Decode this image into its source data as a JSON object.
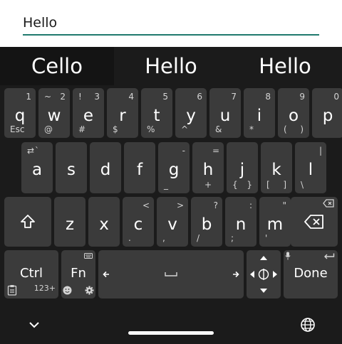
{
  "input": {
    "value": "Hello"
  },
  "suggestions": [
    "Cello",
    "Hello",
    "Hello"
  ],
  "accent_color": "#1f7a6e",
  "rows": {
    "r1": [
      {
        "main": "q",
        "tr": "1",
        "bl": "Esc",
        "name": "key-q"
      },
      {
        "main": "w",
        "tl": "~",
        "tr": "2",
        "bl": "@",
        "name": "key-w"
      },
      {
        "main": "e",
        "tl": "!",
        "tr": "3",
        "bl": "#",
        "name": "key-e"
      },
      {
        "main": "r",
        "tr": "4",
        "bl": "$",
        "name": "key-r"
      },
      {
        "main": "t",
        "tr": "5",
        "bl": "%",
        "name": "key-t"
      },
      {
        "main": "y",
        "tr": "6",
        "bl": "^",
        "name": "key-y"
      },
      {
        "main": "u",
        "tr": "7",
        "bl": "&",
        "name": "key-u"
      },
      {
        "main": "i",
        "tr": "8",
        "bl": "*",
        "name": "key-i"
      },
      {
        "main": "o",
        "tr": "9",
        "bl": "(",
        "br": ")",
        "name": "key-o"
      },
      {
        "main": "p",
        "tr": "0",
        "name": "key-p"
      }
    ],
    "r2": [
      {
        "main": "a",
        "tl": "⇄",
        "tm": "`",
        "name": "key-a"
      },
      {
        "main": "s",
        "name": "key-s"
      },
      {
        "main": "d",
        "name": "key-d"
      },
      {
        "main": "f",
        "name": "key-f"
      },
      {
        "main": "g",
        "tr": "-",
        "bl": "_",
        "name": "key-g"
      },
      {
        "main": "h",
        "tr": "=",
        "bm": "+",
        "name": "key-h"
      },
      {
        "main": "j",
        "bl": "{",
        "br": "}",
        "name": "key-j"
      },
      {
        "main": "k",
        "bl": "[",
        "br": "]",
        "name": "key-k"
      },
      {
        "main": "l",
        "tr": "|",
        "bl": "\\",
        "name": "key-l"
      }
    ],
    "r3": [
      {
        "main": "z",
        "name": "key-z"
      },
      {
        "main": "x",
        "name": "key-x"
      },
      {
        "main": "c",
        "tr": "<",
        "bl": ".",
        "name": "key-c"
      },
      {
        "main": "v",
        "tr": ">",
        "bl": ",",
        "name": "key-v"
      },
      {
        "main": "b",
        "tr": "?",
        "bl": "/",
        "name": "key-b"
      },
      {
        "main": "n",
        "tr": ":",
        "bl": ";",
        "name": "key-n"
      },
      {
        "main": "m",
        "tr": "\"",
        "bl": "'",
        "name": "key-m"
      }
    ]
  },
  "bottom": {
    "ctrl_label": "Ctrl",
    "fn_label": "Fn",
    "num_label": "123+",
    "done_label": "Done"
  }
}
